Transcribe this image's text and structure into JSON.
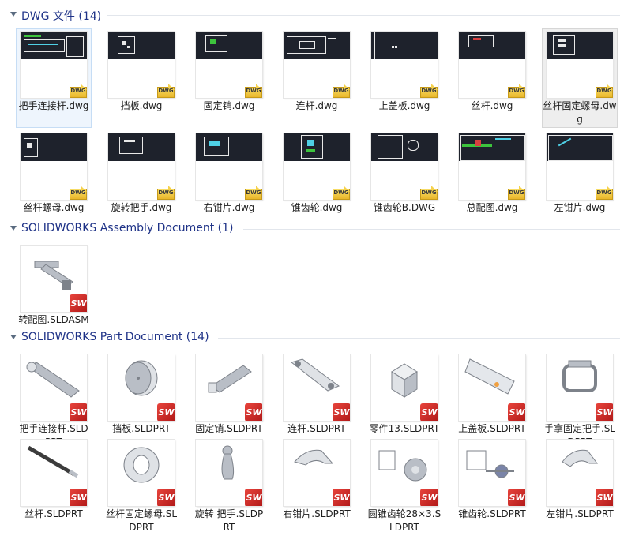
{
  "groups": [
    {
      "title": "DWG 文件 (14)",
      "items": [
        {
          "label": "把手连接杆.dwg",
          "badge": "DWG",
          "state": "selected"
        },
        {
          "label": "挡板.dwg",
          "badge": "DWG"
        },
        {
          "label": "固定销.dwg",
          "badge": "DWG"
        },
        {
          "label": "连杆.dwg",
          "badge": "DWG"
        },
        {
          "label": "上盖板.dwg",
          "badge": "DWG"
        },
        {
          "label": "丝杆.dwg",
          "badge": "DWG"
        },
        {
          "label": "丝杆固定螺母.dwg",
          "badge": "DWG",
          "state": "hovered"
        },
        {
          "label": "丝杆螺母.dwg",
          "badge": "DWG"
        },
        {
          "label": "旋转把手.dwg",
          "badge": "DWG"
        },
        {
          "label": "右钳片.dwg",
          "badge": "DWG"
        },
        {
          "label": "锥齿轮.dwg",
          "badge": "DWG"
        },
        {
          "label": "锥齿轮B.DWG",
          "badge": "DWG"
        },
        {
          "label": "总配图.dwg",
          "badge": "DWG"
        },
        {
          "label": "左钳片.dwg",
          "badge": "DWG"
        }
      ]
    },
    {
      "title": "SOLIDWORKS Assembly Document (1)",
      "items": [
        {
          "label": "转配图.SLDASM",
          "badge": "SW"
        }
      ]
    },
    {
      "title": "SOLIDWORKS Part Document (14)",
      "items": [
        {
          "label": "把手连接杆.SLDPRT",
          "badge": "SW"
        },
        {
          "label": "挡板.SLDPRT",
          "badge": "SW"
        },
        {
          "label": "固定销.SLDPRT",
          "badge": "SW"
        },
        {
          "label": "连杆.SLDPRT",
          "badge": "SW"
        },
        {
          "label": "零件13.SLDPRT",
          "badge": "SW"
        },
        {
          "label": "上盖板.SLDPRT",
          "badge": "SW"
        },
        {
          "label": "手拿固定把手.SLDPRT",
          "badge": "SW"
        },
        {
          "label": "丝杆.SLDPRT",
          "badge": "SW"
        },
        {
          "label": "丝杆固定螺母.SLDPRT",
          "badge": "SW"
        },
        {
          "label": "旋转 把手.SLDPRT",
          "badge": "SW"
        },
        {
          "label": "右钳片.SLDPRT",
          "badge": "SW"
        },
        {
          "label": "圆锥齿轮28×3.SLDPRT",
          "badge": "SW"
        },
        {
          "label": "锥齿轮.SLDPRT",
          "badge": "SW"
        },
        {
          "label": "左钳片.SLDPRT",
          "badge": "SW"
        }
      ]
    }
  ],
  "badges": {
    "dwg_text": "DWG",
    "sw_text": "SW"
  },
  "colors": {
    "group_title": "#1e3287",
    "selected_bg": "#eef5fd",
    "dwg_dark": "#1e222c",
    "sw_red": "#c8201c"
  },
  "icons": [
    "collapse-arrow-icon",
    "dwg-file-icon",
    "solidworks-file-icon"
  ]
}
